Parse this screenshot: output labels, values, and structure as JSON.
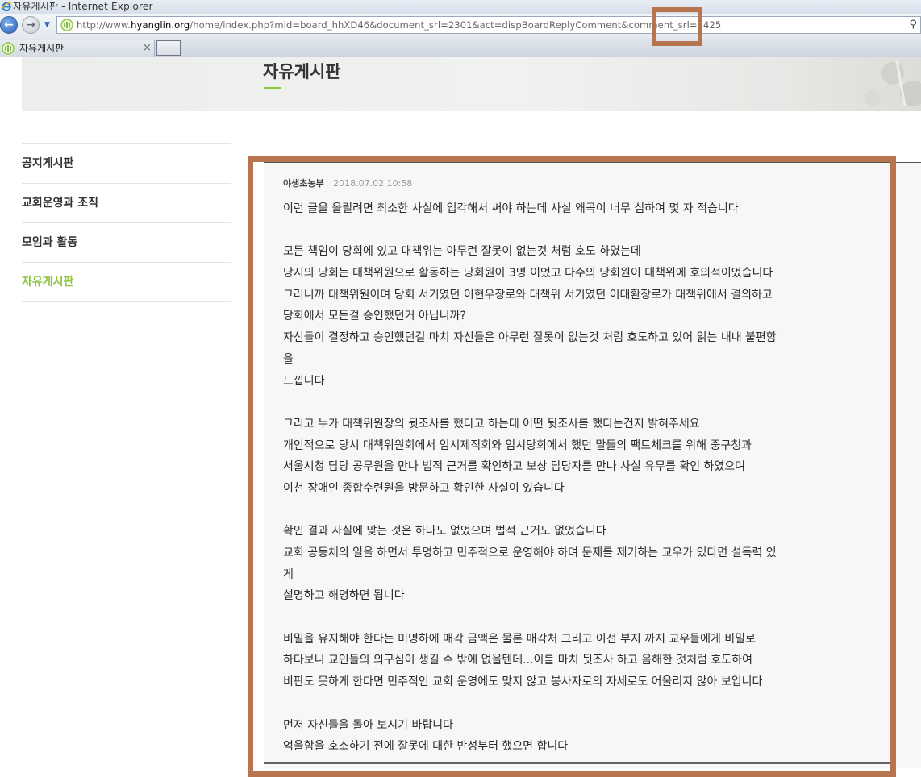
{
  "window": {
    "title": "자유게시판 - Internet Explorer"
  },
  "address_bar": {
    "url_prefix": "http://www.",
    "url_domain": "hyanglin.org",
    "url_rest": "/home/index.php?mid=board_hhXD46&document_srl=2301&act=dispBoardReplyComment&comment_srl=2425"
  },
  "tab": {
    "title": "자유게시판",
    "close_symbol": "×"
  },
  "header": {
    "title": "자유게시판",
    "accent_color": "#8cc63f"
  },
  "sidebar": {
    "items": [
      {
        "label": "공지게시판",
        "active": false
      },
      {
        "label": "교회운영과 조직",
        "active": false
      },
      {
        "label": "모임과 활동",
        "active": false
      },
      {
        "label": "자유게시판",
        "active": true
      }
    ]
  },
  "comment": {
    "author": "야생초농부",
    "date": "2018.07.02 10:58",
    "lines": [
      "이런 글을 올릴려면 최소한 사실에 입각해서 써야 하는데 사실 왜곡이 너무 심하여 몇 자 적습니다",
      "",
      "모든 책임이 당회에 있고 대책위는 아무런 잘못이 없는것 처럼 호도 하였는데",
      "당시의 당회는 대책위원으로 활동하는 당회원이 3명 이었고 다수의 당회원이 대책위에 호의적이었습니다",
      "그러니까 대책위원이며 당회 서기였던 이현우장로와 대책위 서기였던 이태환장로가 대책위에서 결의하고",
      "당회에서 모든걸 승인했던거 아닙니까?",
      "자신들이 결정하고 승인했던걸 마치 자신들은 아무런 잘못이 없는것 처럼 호도하고 있어 읽는 내내 불편함",
      "을",
      "느낍니다",
      "",
      "그리고 누가 대책위원장의 뒷조사를 했다고 하는데 어떤 뒷조사를 했다는건지 밝혀주세요",
      "개인적으로 당시 대책위원회에서 임시제직회와 임시당회에서 했던 말들의 팩트체크를 위해 중구청과",
      "서울시청 담당 공무원을 만나 법적 근거를 확인하고 보상 담당자를 만나 사실 유무를 확인 하였으며",
      "이천 장애인 종합수련원을 방문하고 확인한 사실이 있습니다",
      "",
      "확인 결과 사실에 맞는 것은 하나도 없었으며 법적 근거도 없었습니다",
      "교회 공동체의 일을 하면서 투명하고 민주적으로 운영해야 하며 문제를 제기하는 교우가 있다면 설득력 있",
      "게",
      "설명하고 해명하면 됩니다",
      "",
      "비밀을 유지해야 한다는 미명하에 매각 금액은 물론 매각처 그리고 이전 부지 까지 교우들에게 비밀로",
      "하다보니 교인들의 의구심이 생길 수 밖에 없을텐데...이를 마치 뒷조사 하고 음해한 것처럼 호도하여",
      "비판도 못하게 한다면 민주적인 교회 운영에도 맞지 않고 봉사자로의 자세로도 어울리지 않아 보입니다",
      "",
      "먼저 자신들을 돌아 보시기 바랍니다",
      "억울함을 호소하기 전에 잘못에 대한 반성부터 했으면 합니다"
    ]
  },
  "highlight": {
    "color": "#b8744f"
  }
}
